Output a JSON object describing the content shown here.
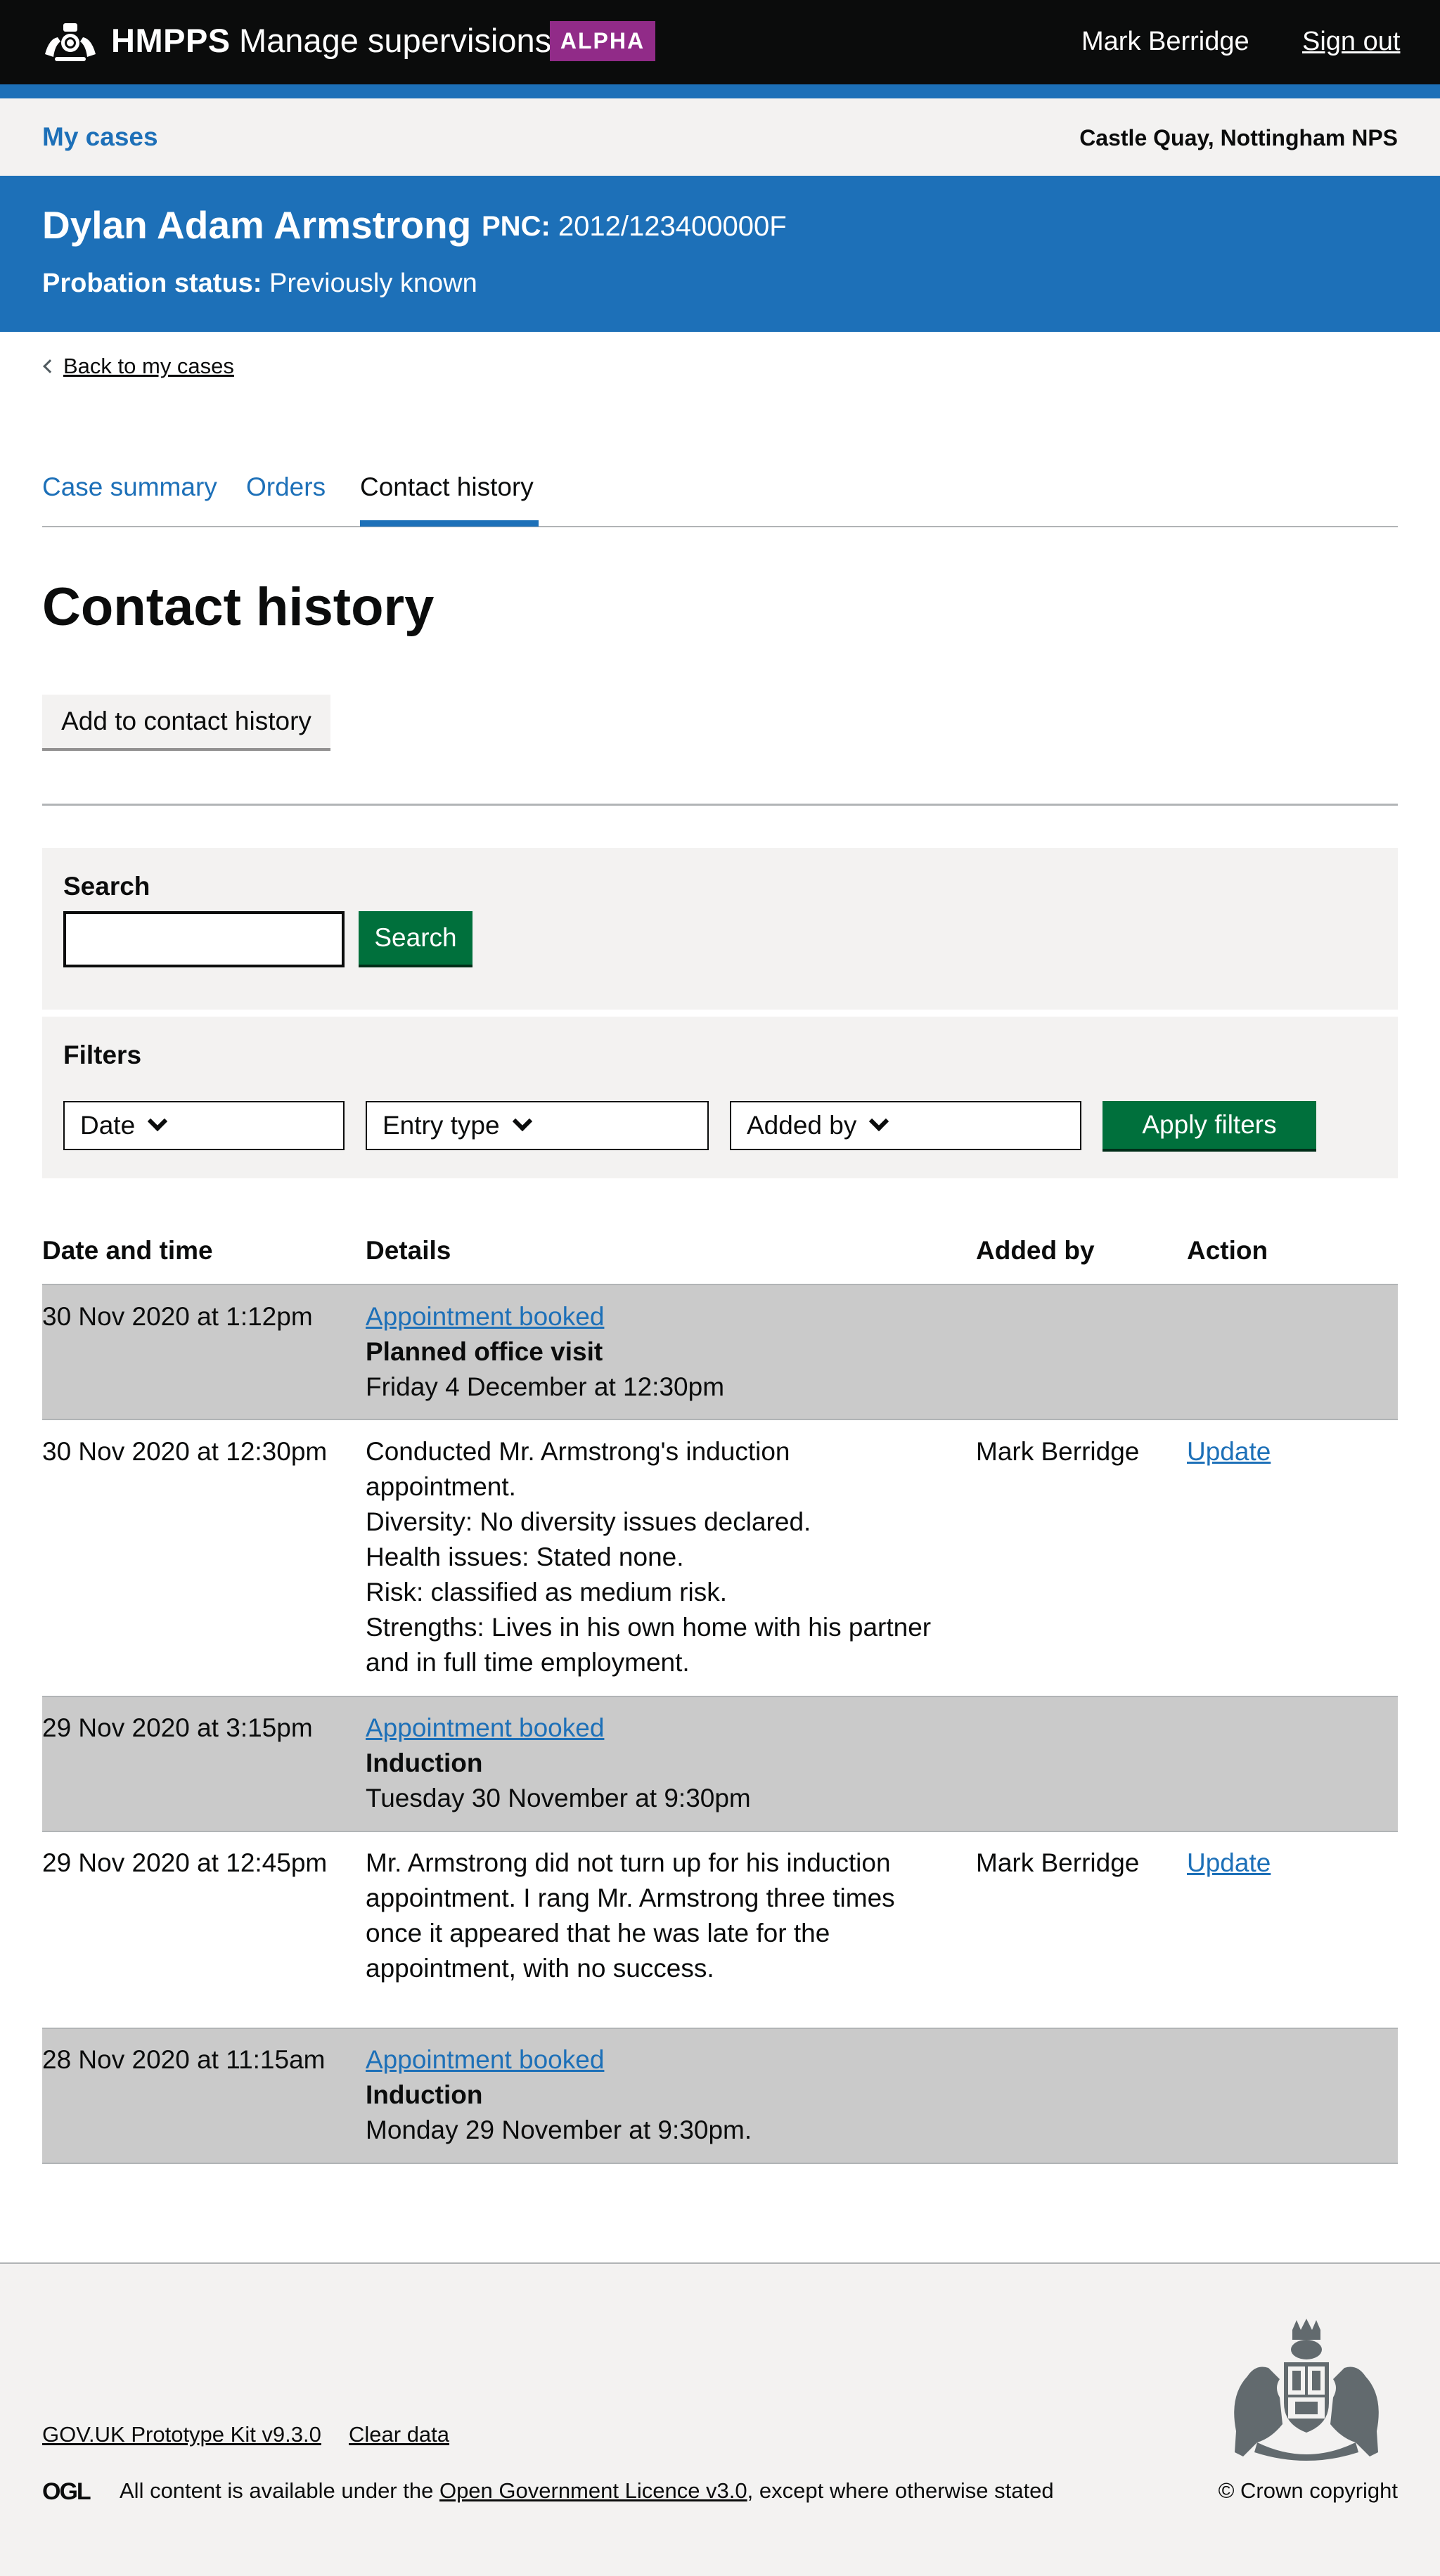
{
  "header": {
    "org": "HMPPS",
    "service_name": "Manage supervisions",
    "phase": "ALPHA",
    "user_name": "Mark Berridge",
    "sign_out": "Sign out"
  },
  "subnav": {
    "my_cases": "My cases",
    "location": "Castle Quay, Nottingham NPS"
  },
  "person": {
    "name": "Dylan Adam Armstrong",
    "pnc_label": "PNC:",
    "pnc_value": "2012/123400000F",
    "status_label": "Probation status:",
    "status_value": "Previously known"
  },
  "back_link": "Back to my cases",
  "tabs": [
    {
      "label": "Case summary",
      "active": false
    },
    {
      "label": "Orders",
      "active": false
    },
    {
      "label": "Contact history",
      "active": true
    }
  ],
  "page_title": "Contact history",
  "add_button": "Add to contact history",
  "search": {
    "label": "Search",
    "value": "",
    "button": "Search"
  },
  "filters": {
    "label": "Filters",
    "selects": [
      "Date",
      "Entry type",
      "Added by"
    ],
    "apply_button": "Apply filters"
  },
  "table": {
    "headers": [
      "Date and time",
      "Details",
      "Added by",
      "Action"
    ],
    "rows": [
      {
        "datetime": "30 Nov 2020 at 1:12pm",
        "link": "Appointment booked",
        "title": "Planned office visit",
        "detail": "Friday 4 December at 12:30pm",
        "added_by": "",
        "action": ""
      },
      {
        "datetime": "30 Nov 2020 at 12:30pm",
        "lines": [
          "Conducted Mr. Armstrong's induction",
          "appointment.",
          "Diversity: No diversity issues declared.",
          "Health issues: Stated none.",
          "Risk: classified as medium risk.",
          "Strengths: Lives in his own home with his partner",
          "and in full time employment."
        ],
        "added_by": "Mark Berridge",
        "action": "Update"
      },
      {
        "datetime": "29 Nov 2020 at 3:15pm",
        "link": "Appointment booked",
        "title": "Induction",
        "detail": "Tuesday 30 November at 9:30pm",
        "added_by": "",
        "action": ""
      },
      {
        "datetime": "29 Nov 2020 at 12:45pm",
        "lines": [
          "Mr. Armstrong did not turn up for his induction",
          "appointment. I rang Mr. Armstrong three times",
          "once it appeared that he was late for the",
          "appointment, with no success."
        ],
        "added_by": "Mark Berridge",
        "action": "Update"
      },
      {
        "datetime": "28 Nov 2020 at 11:15am",
        "link": "Appointment booked",
        "title": "Induction",
        "detail": "Monday 29 November at 9:30pm.",
        "added_by": "",
        "action": ""
      }
    ]
  },
  "footer": {
    "prototype_kit": "GOV.UK Prototype Kit v9.3.0",
    "clear_data": "Clear data",
    "licence_prefix": "All content is available under the ",
    "licence_link": "Open Government Licence v3.0",
    "licence_suffix": ", except where otherwise stated",
    "copyright": "© Crown copyright",
    "ogl_logo_text": "OGL"
  },
  "colors": {
    "header_bg": "#0b0c0c",
    "brand_blue": "#1d70b8",
    "alpha_tag": "#912b88",
    "button_green": "#00703c",
    "panel_grey": "#f3f2f1",
    "row_shade": "#cacaca"
  },
  "icons": {
    "header_logo": "royal-crest-icon",
    "back": "chevron-left-icon",
    "select": "chevron-down-icon",
    "footer_logo": "royal-coat-of-arms-icon",
    "licence": "ogl-logo-icon"
  }
}
